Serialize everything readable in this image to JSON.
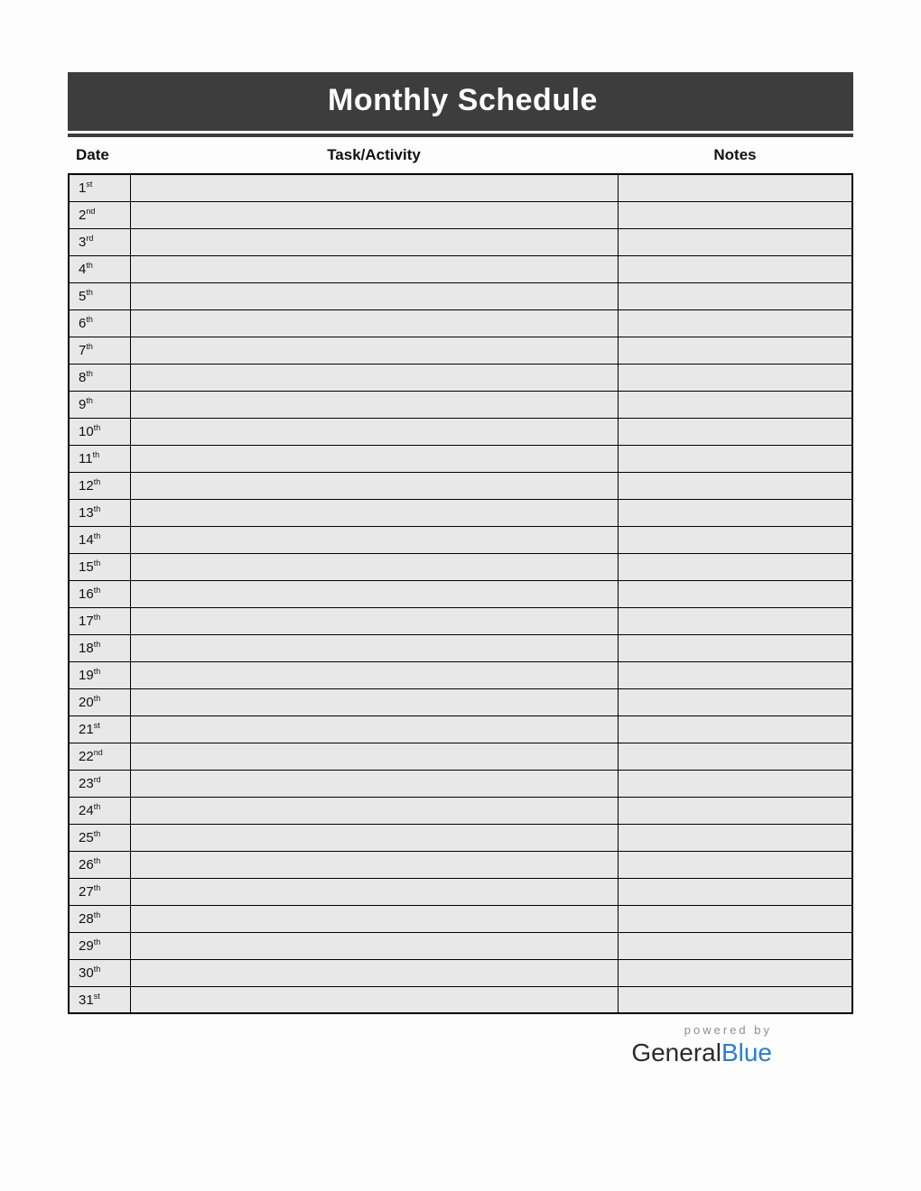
{
  "title": "Monthly Schedule",
  "headers": {
    "date": "Date",
    "task": "Task/Activity",
    "notes": "Notes"
  },
  "rows": [
    {
      "num": "1",
      "ord": "st",
      "task": "",
      "notes": ""
    },
    {
      "num": "2",
      "ord": "nd",
      "task": "",
      "notes": ""
    },
    {
      "num": "3",
      "ord": "rd",
      "task": "",
      "notes": ""
    },
    {
      "num": "4",
      "ord": "th",
      "task": "",
      "notes": ""
    },
    {
      "num": "5",
      "ord": "th",
      "task": "",
      "notes": ""
    },
    {
      "num": "6",
      "ord": "th",
      "task": "",
      "notes": ""
    },
    {
      "num": "7",
      "ord": "th",
      "task": "",
      "notes": ""
    },
    {
      "num": "8",
      "ord": "th",
      "task": "",
      "notes": ""
    },
    {
      "num": "9",
      "ord": "th",
      "task": "",
      "notes": ""
    },
    {
      "num": "10",
      "ord": "th",
      "task": "",
      "notes": ""
    },
    {
      "num": "11",
      "ord": "th",
      "task": "",
      "notes": ""
    },
    {
      "num": "12",
      "ord": "th",
      "task": "",
      "notes": ""
    },
    {
      "num": "13",
      "ord": "th",
      "task": "",
      "notes": ""
    },
    {
      "num": "14",
      "ord": "th",
      "task": "",
      "notes": ""
    },
    {
      "num": "15",
      "ord": "th",
      "task": "",
      "notes": ""
    },
    {
      "num": "16",
      "ord": "th",
      "task": "",
      "notes": ""
    },
    {
      "num": "17",
      "ord": "th",
      "task": "",
      "notes": ""
    },
    {
      "num": "18",
      "ord": "th",
      "task": "",
      "notes": ""
    },
    {
      "num": "19",
      "ord": "th",
      "task": "",
      "notes": ""
    },
    {
      "num": "20",
      "ord": "th",
      "task": "",
      "notes": ""
    },
    {
      "num": "21",
      "ord": "st",
      "task": "",
      "notes": ""
    },
    {
      "num": "22",
      "ord": "nd",
      "task": "",
      "notes": ""
    },
    {
      "num": "23",
      "ord": "rd",
      "task": "",
      "notes": ""
    },
    {
      "num": "24",
      "ord": "th",
      "task": "",
      "notes": ""
    },
    {
      "num": "25",
      "ord": "th",
      "task": "",
      "notes": ""
    },
    {
      "num": "26",
      "ord": "th",
      "task": "",
      "notes": ""
    },
    {
      "num": "27",
      "ord": "th",
      "task": "",
      "notes": ""
    },
    {
      "num": "28",
      "ord": "th",
      "task": "",
      "notes": ""
    },
    {
      "num": "29",
      "ord": "th",
      "task": "",
      "notes": ""
    },
    {
      "num": "30",
      "ord": "th",
      "task": "",
      "notes": ""
    },
    {
      "num": "31",
      "ord": "st",
      "task": "",
      "notes": ""
    }
  ],
  "footer": {
    "powered": "powered by",
    "brand1": "General",
    "brand2": "Blue"
  }
}
